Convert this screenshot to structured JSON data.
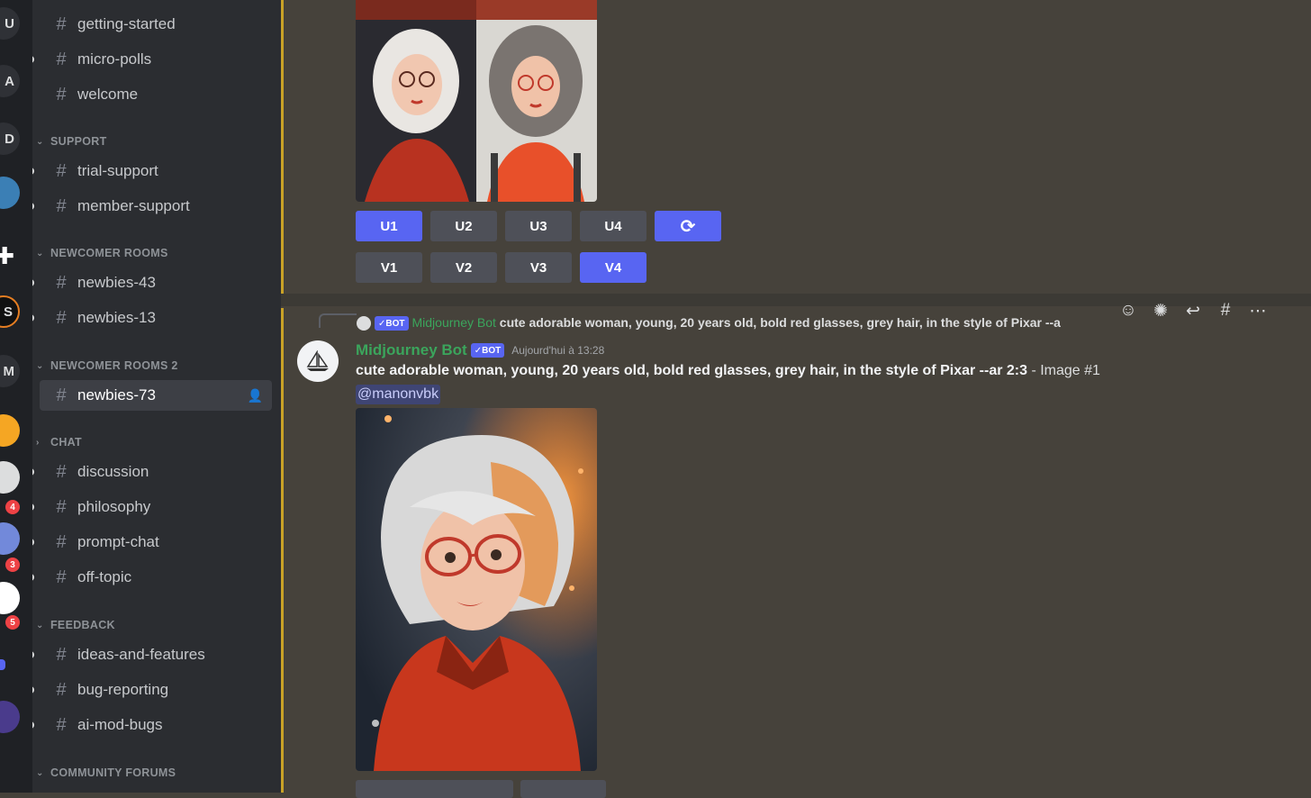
{
  "servers": [
    {
      "letter": "U",
      "badge": ""
    },
    {
      "letter": "A",
      "badge": ""
    },
    {
      "letter": "D",
      "badge": ""
    },
    {
      "letter": "",
      "badge": ""
    },
    {
      "letter": "",
      "badge": ""
    },
    {
      "letter": "S",
      "badge": ""
    },
    {
      "letter": "M",
      "badge": ""
    },
    {
      "letter": "",
      "badge": ""
    },
    {
      "letter": "",
      "badge": "4"
    },
    {
      "letter": "",
      "badge": "3"
    },
    {
      "letter": "",
      "badge": "5"
    }
  ],
  "sidebar": {
    "categories": [
      {
        "label": "SUPPORT"
      },
      {
        "label": "NEWCOMER ROOMS"
      },
      {
        "label": "NEWCOMER ROOMS 2"
      },
      {
        "label": "CHAT"
      },
      {
        "label": "FEEDBACK"
      },
      {
        "label": "COMMUNITY FORUMS"
      }
    ],
    "channels": [
      {
        "name": "getting-started"
      },
      {
        "name": "micro-polls"
      },
      {
        "name": "welcome"
      },
      {
        "name": "trial-support"
      },
      {
        "name": "member-support"
      },
      {
        "name": "newbies-43"
      },
      {
        "name": "newbies-13"
      },
      {
        "name": "newbies-73"
      },
      {
        "name": "discussion"
      },
      {
        "name": "philosophy"
      },
      {
        "name": "prompt-chat"
      },
      {
        "name": "off-topic"
      },
      {
        "name": "ideas-and-features"
      },
      {
        "name": "bug-reporting"
      },
      {
        "name": "ai-mod-bugs"
      }
    ]
  },
  "grid_buttons": {
    "upscale": [
      "U1",
      "U2",
      "U3",
      "U4"
    ],
    "variation": [
      "V1",
      "V2",
      "V3",
      "V4"
    ]
  },
  "message": {
    "reply_author": "Midjourney Bot",
    "reply_badge": "BOT",
    "reply_text": "cute adorable woman, young, 20 years old, bold red glasses, grey hair, in the style of Pixar --a",
    "author": "Midjourney Bot",
    "badge": "BOT",
    "timestamp": "Aujourd'hui à 13:28",
    "prompt": "cute adorable woman, young, 20 years old, bold red glasses, grey hair, in the style of Pixar --ar 2:3",
    "suffix": " - Image #1",
    "mention": "@manonvbk"
  },
  "colors": {
    "blurple": "#5865f2",
    "bot_green": "#3ba55c",
    "accent": "#c9a227"
  }
}
